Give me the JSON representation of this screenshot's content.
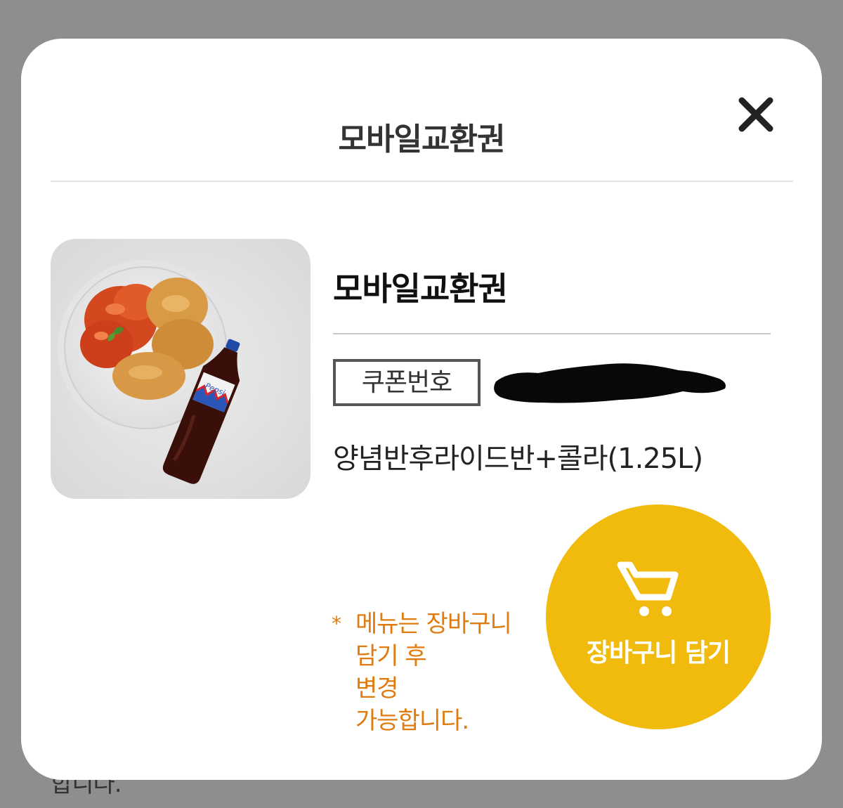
{
  "background": {
    "peek_text": "합니다."
  },
  "modal": {
    "title": "모바일교환권",
    "close_icon": "close-icon"
  },
  "product": {
    "image_alt": "양념 후라이드 치킨과 펩시 콜라",
    "name": "모바일교환권",
    "coupon_label": "쿠폰번호",
    "coupon_number_redacted": true,
    "menu": "양념반후라이드반+콜라(1.25L)"
  },
  "note": {
    "star": "*",
    "lines": [
      "메뉴는 장바구니",
      "담기 후",
      "변경",
      "가능합니다."
    ]
  },
  "cart_button": {
    "label": "장바구니 담기",
    "icon": "shopping-cart-icon"
  },
  "colors": {
    "accent": "#f0bb0c",
    "note": "#e07b10",
    "overlay": "#8e8e8e"
  }
}
